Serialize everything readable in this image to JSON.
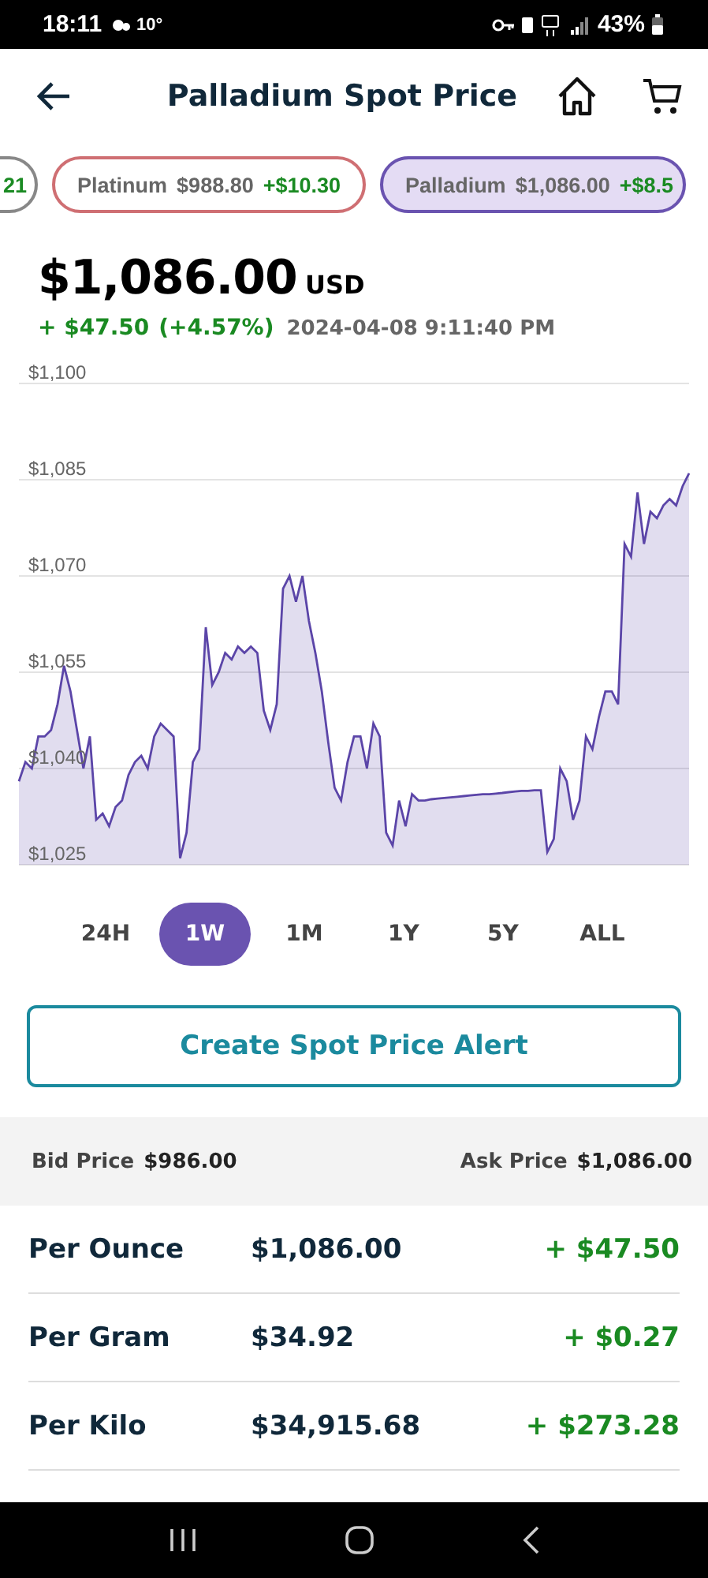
{
  "status_bar": {
    "time": "18:11",
    "temperature": "10°",
    "battery": "43%"
  },
  "header": {
    "title": "Palladium Spot Price"
  },
  "chips": [
    {
      "change": "21",
      "color": "#888888",
      "selected": false
    },
    {
      "name": "Platinum",
      "price": "$988.80",
      "change": "+$10.30",
      "color": "#cf6f73",
      "selected": false
    },
    {
      "name": "Palladium",
      "price": "$1,086.00",
      "change": "+$8.5",
      "color": "#6a53b0",
      "selected": true
    }
  ],
  "quote": {
    "price": "$1,086.00",
    "currency": "USD",
    "change": "+ $47.50",
    "percent": "(+4.57%)",
    "timestamp": "2024-04-08 9:11:40 PM"
  },
  "chart_data": {
    "type": "area",
    "grid": true,
    "ylim": [
      1025,
      1100
    ],
    "yticks": [
      {
        "value": 1025,
        "label": "$1,025"
      },
      {
        "value": 1040,
        "label": "$1,040"
      },
      {
        "value": 1055,
        "label": "$1,055"
      },
      {
        "value": 1070,
        "label": "$1,070"
      },
      {
        "value": 1085,
        "label": "$1,085"
      },
      {
        "value": 1100,
        "label": "$1,100"
      }
    ],
    "series": [
      {
        "color": "#5b45a8",
        "values": [
          1038,
          1041,
          1040,
          1045,
          1045,
          1046,
          1050,
          1056,
          1052,
          1046,
          1040,
          1045,
          1032,
          1033,
          1031,
          1034,
          1035,
          1039,
          1041,
          1042,
          1040,
          1045,
          1047,
          1046,
          1045,
          1026,
          1030,
          1041,
          1043,
          1062,
          1053,
          1055,
          1058,
          1057,
          1059,
          1058,
          1059,
          1058,
          1049,
          1046,
          1050,
          1068,
          1070,
          1066,
          1070,
          1063,
          1058,
          1052,
          1044,
          1037,
          1035,
          1041,
          1045,
          1045,
          1040,
          1047,
          1045,
          1030,
          1028,
          1035,
          1031,
          1036,
          1035,
          1035,
          1035.2,
          1035.3,
          1035.4,
          1035.5,
          1035.6,
          1035.7,
          1035.8,
          1035.9,
          1036,
          1036,
          1036.1,
          1036.2,
          1036.3,
          1036.4,
          1036.5,
          1036.5,
          1036.6,
          1036.6,
          1027,
          1029,
          1040,
          1038,
          1032,
          1035,
          1045,
          1043,
          1048,
          1052,
          1052,
          1050,
          1075,
          1073,
          1083,
          1075,
          1080,
          1079,
          1081,
          1082,
          1081,
          1084,
          1086
        ]
      }
    ]
  },
  "periods": [
    {
      "label": "24H",
      "selected": false
    },
    {
      "label": "1W",
      "selected": true
    },
    {
      "label": "1M",
      "selected": false
    },
    {
      "label": "1Y",
      "selected": false
    },
    {
      "label": "5Y",
      "selected": false
    },
    {
      "label": "ALL",
      "selected": false
    }
  ],
  "alert_button": "Create Spot Price Alert",
  "bid": {
    "label": "Bid Price",
    "value": "$986.00"
  },
  "ask": {
    "label": "Ask Price",
    "value": "$1,086.00"
  },
  "rows": [
    {
      "unit": "Per Ounce",
      "price": "$1,086.00",
      "change": "+ $47.50"
    },
    {
      "unit": "Per Gram",
      "price": "$34.92",
      "change": "+ $0.27"
    },
    {
      "unit": "Per Kilo",
      "price": "$34,915.68",
      "change": "+ $273.28"
    }
  ]
}
